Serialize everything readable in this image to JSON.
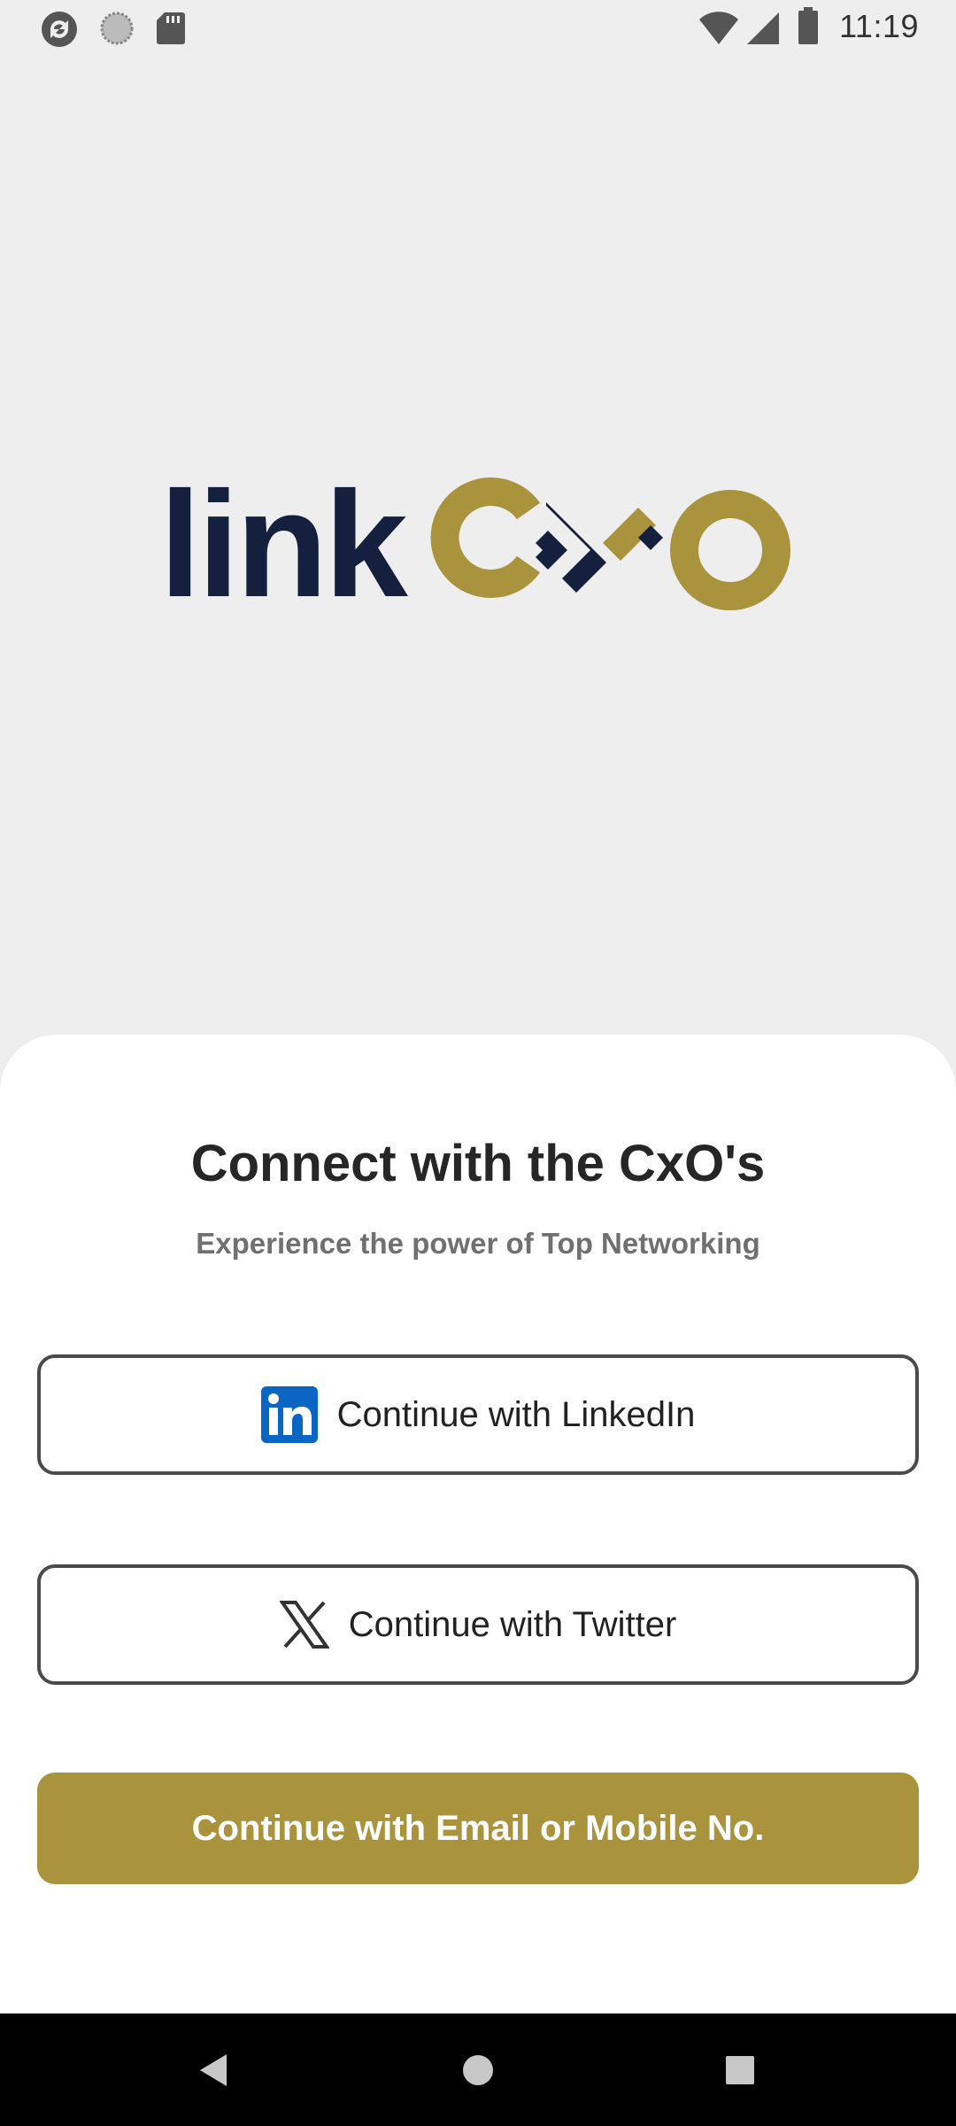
{
  "status_bar": {
    "time": "11:19",
    "icons": [
      "sync-icon",
      "circle-status-icon",
      "sd-card-icon",
      "wifi-icon",
      "signal-icon",
      "battery-icon"
    ]
  },
  "logo": {
    "text_link": "link",
    "brand_colors": {
      "navy": "#15203f",
      "gold": "#a9943d"
    }
  },
  "sheet": {
    "title": "Connect with the CxO's",
    "subtitle": "Experience the power of Top Networking",
    "buttons": {
      "linkedin": {
        "label": "Continue with LinkedIn",
        "icon": "linkedin-icon"
      },
      "twitter": {
        "label": "Continue with Twitter",
        "icon": "x-icon"
      },
      "email": {
        "label": "Continue with Email or Mobile No."
      }
    }
  },
  "nav_bar": {
    "icons": [
      "back-icon",
      "home-icon",
      "recents-icon"
    ]
  }
}
